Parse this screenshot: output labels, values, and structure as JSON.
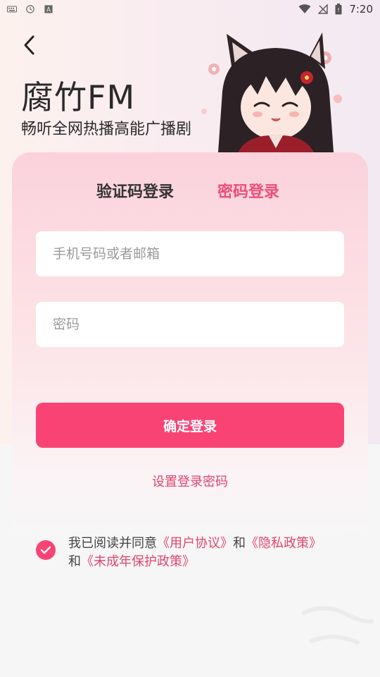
{
  "status_bar": {
    "time": "7:20",
    "left_icons": [
      "keyboard-icon",
      "clock-icon",
      "font-icon"
    ],
    "right_icons": [
      "wifi-icon",
      "signal-off-icon",
      "battery-icon"
    ]
  },
  "header": {
    "back_icon": "chevron-left-icon",
    "brand_title": "腐竹FM",
    "brand_subtitle": "畅听全网热播高能广播剧"
  },
  "login": {
    "tabs": [
      {
        "label": "验证码登录",
        "active": false
      },
      {
        "label": "密码登录",
        "active": true
      }
    ],
    "account_input": {
      "placeholder": "手机号码或者邮箱",
      "value": ""
    },
    "password_input": {
      "placeholder": "密码",
      "value": ""
    },
    "submit_label": "确定登录",
    "set_password_link": "设置登录密码",
    "agreement": {
      "checked": true,
      "prefix": "我已阅读并同意",
      "user_agreement": "《用户协议》",
      "and1": "和",
      "privacy_policy": "《隐私政策》",
      "and2": "和",
      "minor_policy": "《未成年保护政策》"
    }
  },
  "colors": {
    "accent": "#fa4375",
    "accent_text": "#ee4d7a",
    "link": "#e0456f"
  }
}
